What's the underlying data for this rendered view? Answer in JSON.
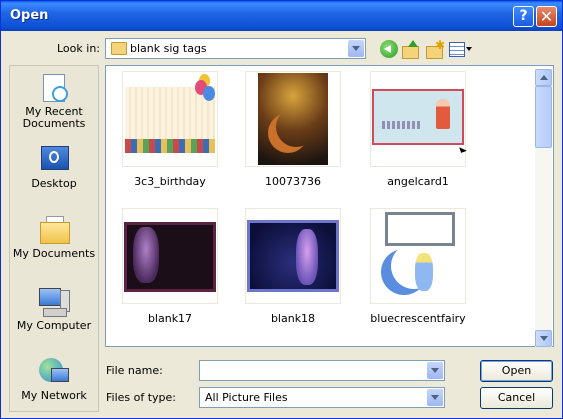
{
  "window": {
    "title": "Open"
  },
  "title_buttons": {
    "help": "?",
    "close": "✕"
  },
  "lookin": {
    "label": "Look in:",
    "value": "blank sig tags"
  },
  "toolbar_icons": [
    "back-icon",
    "up-folder-icon",
    "new-folder-icon",
    "views-menu-icon"
  ],
  "places": [
    {
      "label": "My Recent Documents",
      "icon": "recent-documents-icon"
    },
    {
      "label": "Desktop",
      "icon": "desktop-icon"
    },
    {
      "label": "My Documents",
      "icon": "my-documents-icon"
    },
    {
      "label": "My Computer",
      "icon": "my-computer-icon"
    },
    {
      "label": "My Network",
      "icon": "my-network-icon"
    }
  ],
  "files": [
    {
      "name": "3c3_birthday"
    },
    {
      "name": "10073736"
    },
    {
      "name": "angelcard1"
    },
    {
      "name": "blank17"
    },
    {
      "name": "blank18"
    },
    {
      "name": "bluecrescentfairy"
    }
  ],
  "filename": {
    "label": "File name:",
    "value": ""
  },
  "filetype": {
    "label": "Files of type:",
    "value": "All Picture Files"
  },
  "buttons": {
    "open": "Open",
    "cancel": "Cancel"
  },
  "colors": {
    "titlebar": "#0a5ce6",
    "dialog_bg": "#ece9d8",
    "close": "#c2441e"
  }
}
